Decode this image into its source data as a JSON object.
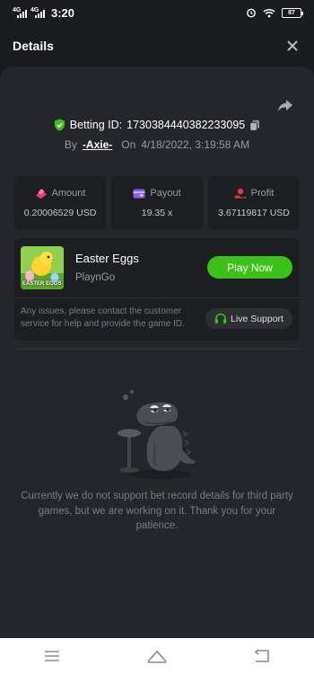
{
  "status": {
    "net1": "4G",
    "net2": "4G",
    "time": "3:20",
    "battery": "87"
  },
  "header": {
    "title": "Details"
  },
  "bet": {
    "id_label": "Betting ID:",
    "id_value": "1730384440382233095",
    "by_label": "By",
    "user": "-Axie-",
    "on_label": "On",
    "datetime": "4/18/2022, 3:19:58 AM"
  },
  "stats": [
    {
      "label": "Amount",
      "value": "0.20006529 USD"
    },
    {
      "label": "Payout",
      "value": "19.35 x"
    },
    {
      "label": "Profit",
      "value": "3.67119817 USD"
    }
  ],
  "game": {
    "name": "Easter Eggs",
    "provider": "PlaynGo",
    "thumb_text": "EASTER EGGS",
    "play_label": "Play Now",
    "support_note": "Any issues, please contact the customer service for help and provide the game ID.",
    "live_support_label": "Live Support"
  },
  "empty_message": "Currently we do not support bet record details for third party games, but we are working on it. Thank you for your patience.",
  "colors": {
    "accent_green": "#3bc117",
    "panel_bg": "#25262b",
    "card_bg": "#1d1e22",
    "amount_icon": "#e23f79",
    "payout_icon": "#8b5cf6",
    "profit_icon": "#e43b3b"
  },
  "icons": {
    "close": "close-icon",
    "share": "share-icon",
    "verified": "shield-check-icon",
    "copy": "copy-icon",
    "amount": "coins-icon",
    "payout": "wallet-icon",
    "profit": "profit-icon",
    "support": "headset-icon"
  }
}
